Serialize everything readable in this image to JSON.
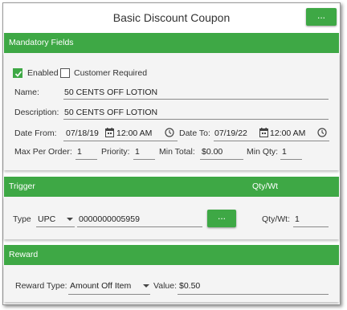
{
  "header": {
    "title": "Basic Discount Coupon",
    "more_label": "..."
  },
  "mandatory": {
    "section_title": "Mandatory Fields",
    "enabled_label": "Enabled",
    "enabled_checked": true,
    "customer_required_label": "Customer Required",
    "customer_required_checked": false,
    "name_label": "Name:",
    "name_value": "50 CENTS OFF LOTION",
    "description_label": "Description:",
    "description_value": "50 CENTS OFF LOTION",
    "date_from_label": "Date From:",
    "date_from_value": "07/18/19",
    "time_from_value": "12:00 AM",
    "date_to_label": "Date To:",
    "date_to_value": "07/19/22",
    "time_to_value": "12:00 AM",
    "max_per_order_label": "Max Per Order:",
    "max_per_order_value": "1",
    "priority_label": "Priority:",
    "priority_value": "1",
    "min_total_label": "Min Total:",
    "min_total_value": "$0.00",
    "min_qty_label": "Min Qty:",
    "min_qty_value": "1"
  },
  "trigger": {
    "section_title": "Trigger",
    "qty_header": "Qty/Wt",
    "type_label": "Type",
    "type_value": "UPC",
    "code_value": "0000000005959",
    "lookup_label": "...",
    "qtywt_label": "Qty/Wt:",
    "qtywt_value": "1"
  },
  "reward": {
    "section_title": "Reward",
    "reward_type_label": "Reward Type:",
    "reward_type_value": "Amount Off Item",
    "value_label": "Value:",
    "value_value": "$0.50"
  },
  "colors": {
    "accent": "#3ea845",
    "panel": "#f4f4f4"
  }
}
